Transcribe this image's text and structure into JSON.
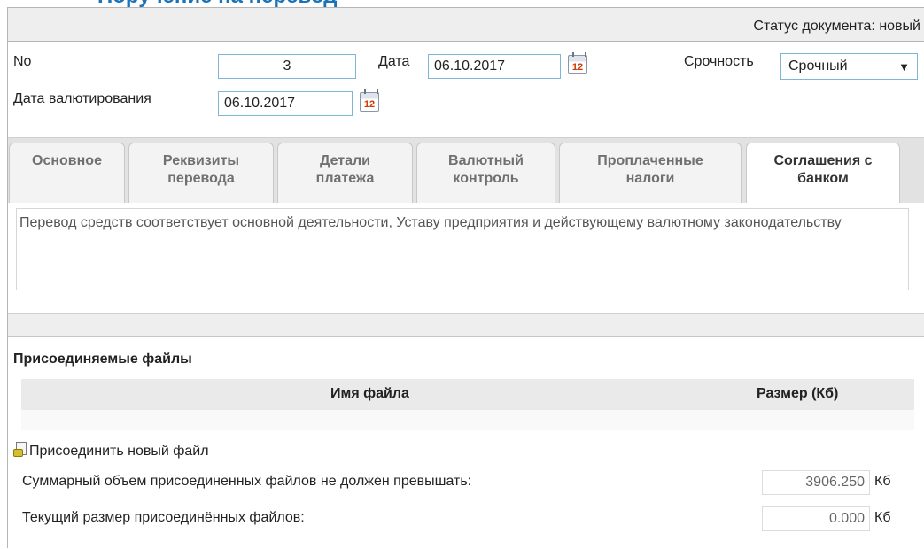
{
  "page": {
    "title": "Поручение на перевод"
  },
  "status": {
    "text": "Статус документа: новый"
  },
  "header": {
    "number_label": "No",
    "number_value": "3",
    "date_label": "Дата",
    "date_value": "06.10.2017",
    "urgency_label": "Срочность",
    "urgency_value": "Срочный",
    "value_date_label": "Дата валютирования",
    "value_date_value": "06.10.2017",
    "calendar_day": "12"
  },
  "tabs": [
    {
      "line1": "Основное",
      "line2": ""
    },
    {
      "line1": "Реквизиты",
      "line2": "перевода"
    },
    {
      "line1": "Детали",
      "line2": "платежа"
    },
    {
      "line1": "Валютный",
      "line2": "контроль"
    },
    {
      "line1": "Проплаченные",
      "line2": "налоги"
    },
    {
      "line1": "Соглашения с",
      "line2": "банком"
    }
  ],
  "agreement": {
    "text": "Перевод средств  соответствует основной  деятельности, Уставу предприятия и действующему валютному законодательству"
  },
  "files": {
    "title": "Присоединяемые файлы",
    "col_name": "Имя файла",
    "col_size": "Размер (Кб)",
    "attach_label": "Присоединить новый файл",
    "total_limit_label": "Суммарный объем присоединенных файлов не должен превышать:",
    "total_limit_value": "3906.250",
    "current_size_label": "Текущий размер присоединённых файлов:",
    "current_size_value": "0.000",
    "unit": "Кб"
  },
  "icons": {
    "calendar": "calendar-icon",
    "attach": "attach-file-icon",
    "dropdown": "chevron-down-icon"
  },
  "colors": {
    "accent_blue": "#1a73b6",
    "field_border": "#7fb6d8",
    "calendar_day": "#d03a00"
  }
}
